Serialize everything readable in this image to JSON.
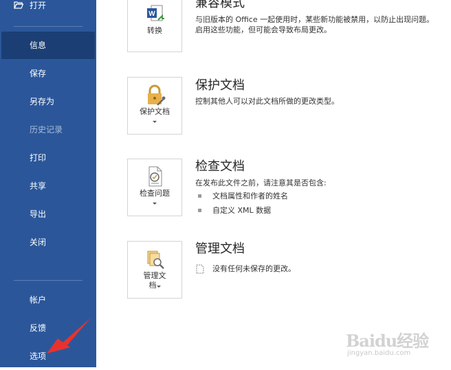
{
  "sidebar": {
    "open_label": "打开",
    "items": [
      {
        "label": "信息"
      },
      {
        "label": "保存"
      },
      {
        "label": "另存为"
      },
      {
        "label": "历史记录"
      },
      {
        "label": "打印"
      },
      {
        "label": "共享"
      },
      {
        "label": "导出"
      },
      {
        "label": "关闭"
      }
    ],
    "bottom": [
      {
        "label": "帐户"
      },
      {
        "label": "反馈"
      },
      {
        "label": "选项"
      }
    ]
  },
  "sections": {
    "compat": {
      "title": "兼容模式",
      "button": "转换",
      "desc1": "与旧版本的 Office 一起使用时，某些新功能被禁用，以防止出现问题。",
      "desc2": "启用这些功能，但可能会导致布局更改。"
    },
    "protect": {
      "title": "保护文档",
      "button": "保护文档",
      "desc": "控制其他人可以对此文档所做的更改类型。"
    },
    "inspect": {
      "title": "检查文档",
      "button": "检查问题",
      "desc": "在发布此文件之前，请注意其是否包含:",
      "bullets": [
        "文档属性和作者的姓名",
        "自定义 XML 数据"
      ]
    },
    "manage": {
      "title": "管理文档",
      "button_line1": "管理文",
      "button_line2": "档",
      "desc": "没有任何未保存的更改。"
    }
  },
  "watermark": {
    "text": "Baidu经验",
    "sub": "jingyan.baidu.com"
  },
  "colors": {
    "sidebar_bg": "#2b579a",
    "sidebar_selected": "#1b3f74",
    "annotation_arrow": "#e8322f"
  }
}
